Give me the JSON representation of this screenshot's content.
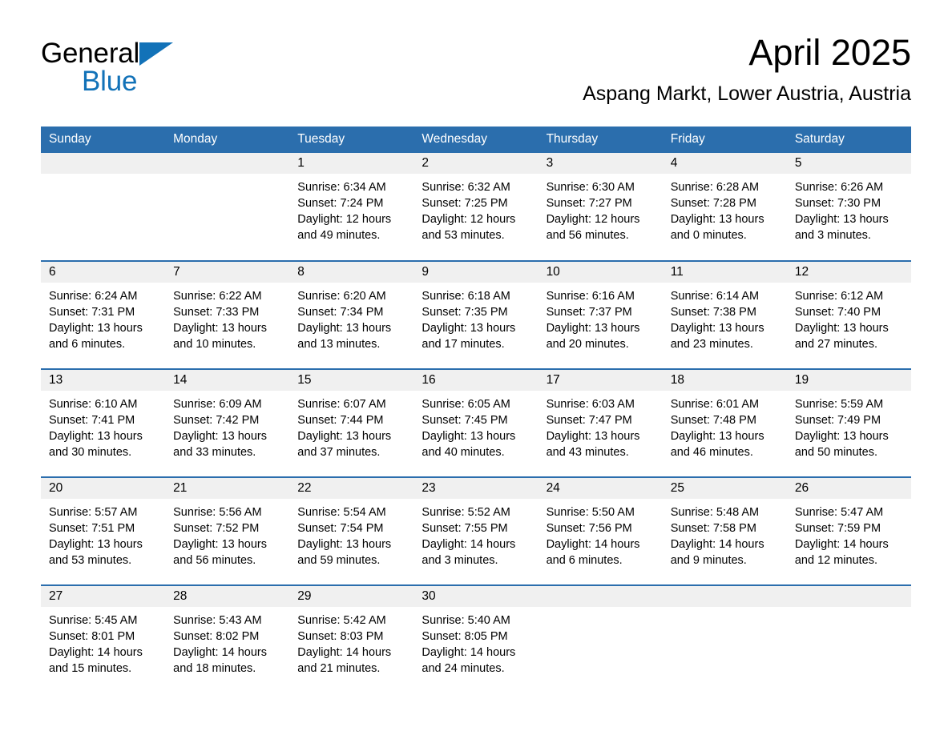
{
  "brand": {
    "line1": "General",
    "line2": "Blue",
    "triangle_color": "#1272b8",
    "text_color": "#1272b8"
  },
  "header": {
    "title": "April 2025",
    "subtitle": "Aspang Markt, Lower Austria, Austria"
  },
  "theme": {
    "header_blue": "#2b6ead",
    "row_divider_blue": "#2b6ead",
    "daynum_band": "#f0f0f0",
    "background": "#ffffff"
  },
  "weekday_headers": [
    "Sunday",
    "Monday",
    "Tuesday",
    "Wednesday",
    "Thursday",
    "Friday",
    "Saturday"
  ],
  "weeks": [
    [
      {
        "day": "",
        "lines": []
      },
      {
        "day": "",
        "lines": []
      },
      {
        "day": "1",
        "lines": [
          "Sunrise: 6:34 AM",
          "Sunset: 7:24 PM",
          "Daylight: 12 hours",
          "and 49 minutes."
        ]
      },
      {
        "day": "2",
        "lines": [
          "Sunrise: 6:32 AM",
          "Sunset: 7:25 PM",
          "Daylight: 12 hours",
          "and 53 minutes."
        ]
      },
      {
        "day": "3",
        "lines": [
          "Sunrise: 6:30 AM",
          "Sunset: 7:27 PM",
          "Daylight: 12 hours",
          "and 56 minutes."
        ]
      },
      {
        "day": "4",
        "lines": [
          "Sunrise: 6:28 AM",
          "Sunset: 7:28 PM",
          "Daylight: 13 hours",
          "and 0 minutes."
        ]
      },
      {
        "day": "5",
        "lines": [
          "Sunrise: 6:26 AM",
          "Sunset: 7:30 PM",
          "Daylight: 13 hours",
          "and 3 minutes."
        ]
      }
    ],
    [
      {
        "day": "6",
        "lines": [
          "Sunrise: 6:24 AM",
          "Sunset: 7:31 PM",
          "Daylight: 13 hours",
          "and 6 minutes."
        ]
      },
      {
        "day": "7",
        "lines": [
          "Sunrise: 6:22 AM",
          "Sunset: 7:33 PM",
          "Daylight: 13 hours",
          "and 10 minutes."
        ]
      },
      {
        "day": "8",
        "lines": [
          "Sunrise: 6:20 AM",
          "Sunset: 7:34 PM",
          "Daylight: 13 hours",
          "and 13 minutes."
        ]
      },
      {
        "day": "9",
        "lines": [
          "Sunrise: 6:18 AM",
          "Sunset: 7:35 PM",
          "Daylight: 13 hours",
          "and 17 minutes."
        ]
      },
      {
        "day": "10",
        "lines": [
          "Sunrise: 6:16 AM",
          "Sunset: 7:37 PM",
          "Daylight: 13 hours",
          "and 20 minutes."
        ]
      },
      {
        "day": "11",
        "lines": [
          "Sunrise: 6:14 AM",
          "Sunset: 7:38 PM",
          "Daylight: 13 hours",
          "and 23 minutes."
        ]
      },
      {
        "day": "12",
        "lines": [
          "Sunrise: 6:12 AM",
          "Sunset: 7:40 PM",
          "Daylight: 13 hours",
          "and 27 minutes."
        ]
      }
    ],
    [
      {
        "day": "13",
        "lines": [
          "Sunrise: 6:10 AM",
          "Sunset: 7:41 PM",
          "Daylight: 13 hours",
          "and 30 minutes."
        ]
      },
      {
        "day": "14",
        "lines": [
          "Sunrise: 6:09 AM",
          "Sunset: 7:42 PM",
          "Daylight: 13 hours",
          "and 33 minutes."
        ]
      },
      {
        "day": "15",
        "lines": [
          "Sunrise: 6:07 AM",
          "Sunset: 7:44 PM",
          "Daylight: 13 hours",
          "and 37 minutes."
        ]
      },
      {
        "day": "16",
        "lines": [
          "Sunrise: 6:05 AM",
          "Sunset: 7:45 PM",
          "Daylight: 13 hours",
          "and 40 minutes."
        ]
      },
      {
        "day": "17",
        "lines": [
          "Sunrise: 6:03 AM",
          "Sunset: 7:47 PM",
          "Daylight: 13 hours",
          "and 43 minutes."
        ]
      },
      {
        "day": "18",
        "lines": [
          "Sunrise: 6:01 AM",
          "Sunset: 7:48 PM",
          "Daylight: 13 hours",
          "and 46 minutes."
        ]
      },
      {
        "day": "19",
        "lines": [
          "Sunrise: 5:59 AM",
          "Sunset: 7:49 PM",
          "Daylight: 13 hours",
          "and 50 minutes."
        ]
      }
    ],
    [
      {
        "day": "20",
        "lines": [
          "Sunrise: 5:57 AM",
          "Sunset: 7:51 PM",
          "Daylight: 13 hours",
          "and 53 minutes."
        ]
      },
      {
        "day": "21",
        "lines": [
          "Sunrise: 5:56 AM",
          "Sunset: 7:52 PM",
          "Daylight: 13 hours",
          "and 56 minutes."
        ]
      },
      {
        "day": "22",
        "lines": [
          "Sunrise: 5:54 AM",
          "Sunset: 7:54 PM",
          "Daylight: 13 hours",
          "and 59 minutes."
        ]
      },
      {
        "day": "23",
        "lines": [
          "Sunrise: 5:52 AM",
          "Sunset: 7:55 PM",
          "Daylight: 14 hours",
          "and 3 minutes."
        ]
      },
      {
        "day": "24",
        "lines": [
          "Sunrise: 5:50 AM",
          "Sunset: 7:56 PM",
          "Daylight: 14 hours",
          "and 6 minutes."
        ]
      },
      {
        "day": "25",
        "lines": [
          "Sunrise: 5:48 AM",
          "Sunset: 7:58 PM",
          "Daylight: 14 hours",
          "and 9 minutes."
        ]
      },
      {
        "day": "26",
        "lines": [
          "Sunrise: 5:47 AM",
          "Sunset: 7:59 PM",
          "Daylight: 14 hours",
          "and 12 minutes."
        ]
      }
    ],
    [
      {
        "day": "27",
        "lines": [
          "Sunrise: 5:45 AM",
          "Sunset: 8:01 PM",
          "Daylight: 14 hours",
          "and 15 minutes."
        ]
      },
      {
        "day": "28",
        "lines": [
          "Sunrise: 5:43 AM",
          "Sunset: 8:02 PM",
          "Daylight: 14 hours",
          "and 18 minutes."
        ]
      },
      {
        "day": "29",
        "lines": [
          "Sunrise: 5:42 AM",
          "Sunset: 8:03 PM",
          "Daylight: 14 hours",
          "and 21 minutes."
        ]
      },
      {
        "day": "30",
        "lines": [
          "Sunrise: 5:40 AM",
          "Sunset: 8:05 PM",
          "Daylight: 14 hours",
          "and 24 minutes."
        ]
      },
      {
        "day": "",
        "lines": []
      },
      {
        "day": "",
        "lines": []
      },
      {
        "day": "",
        "lines": []
      }
    ]
  ]
}
